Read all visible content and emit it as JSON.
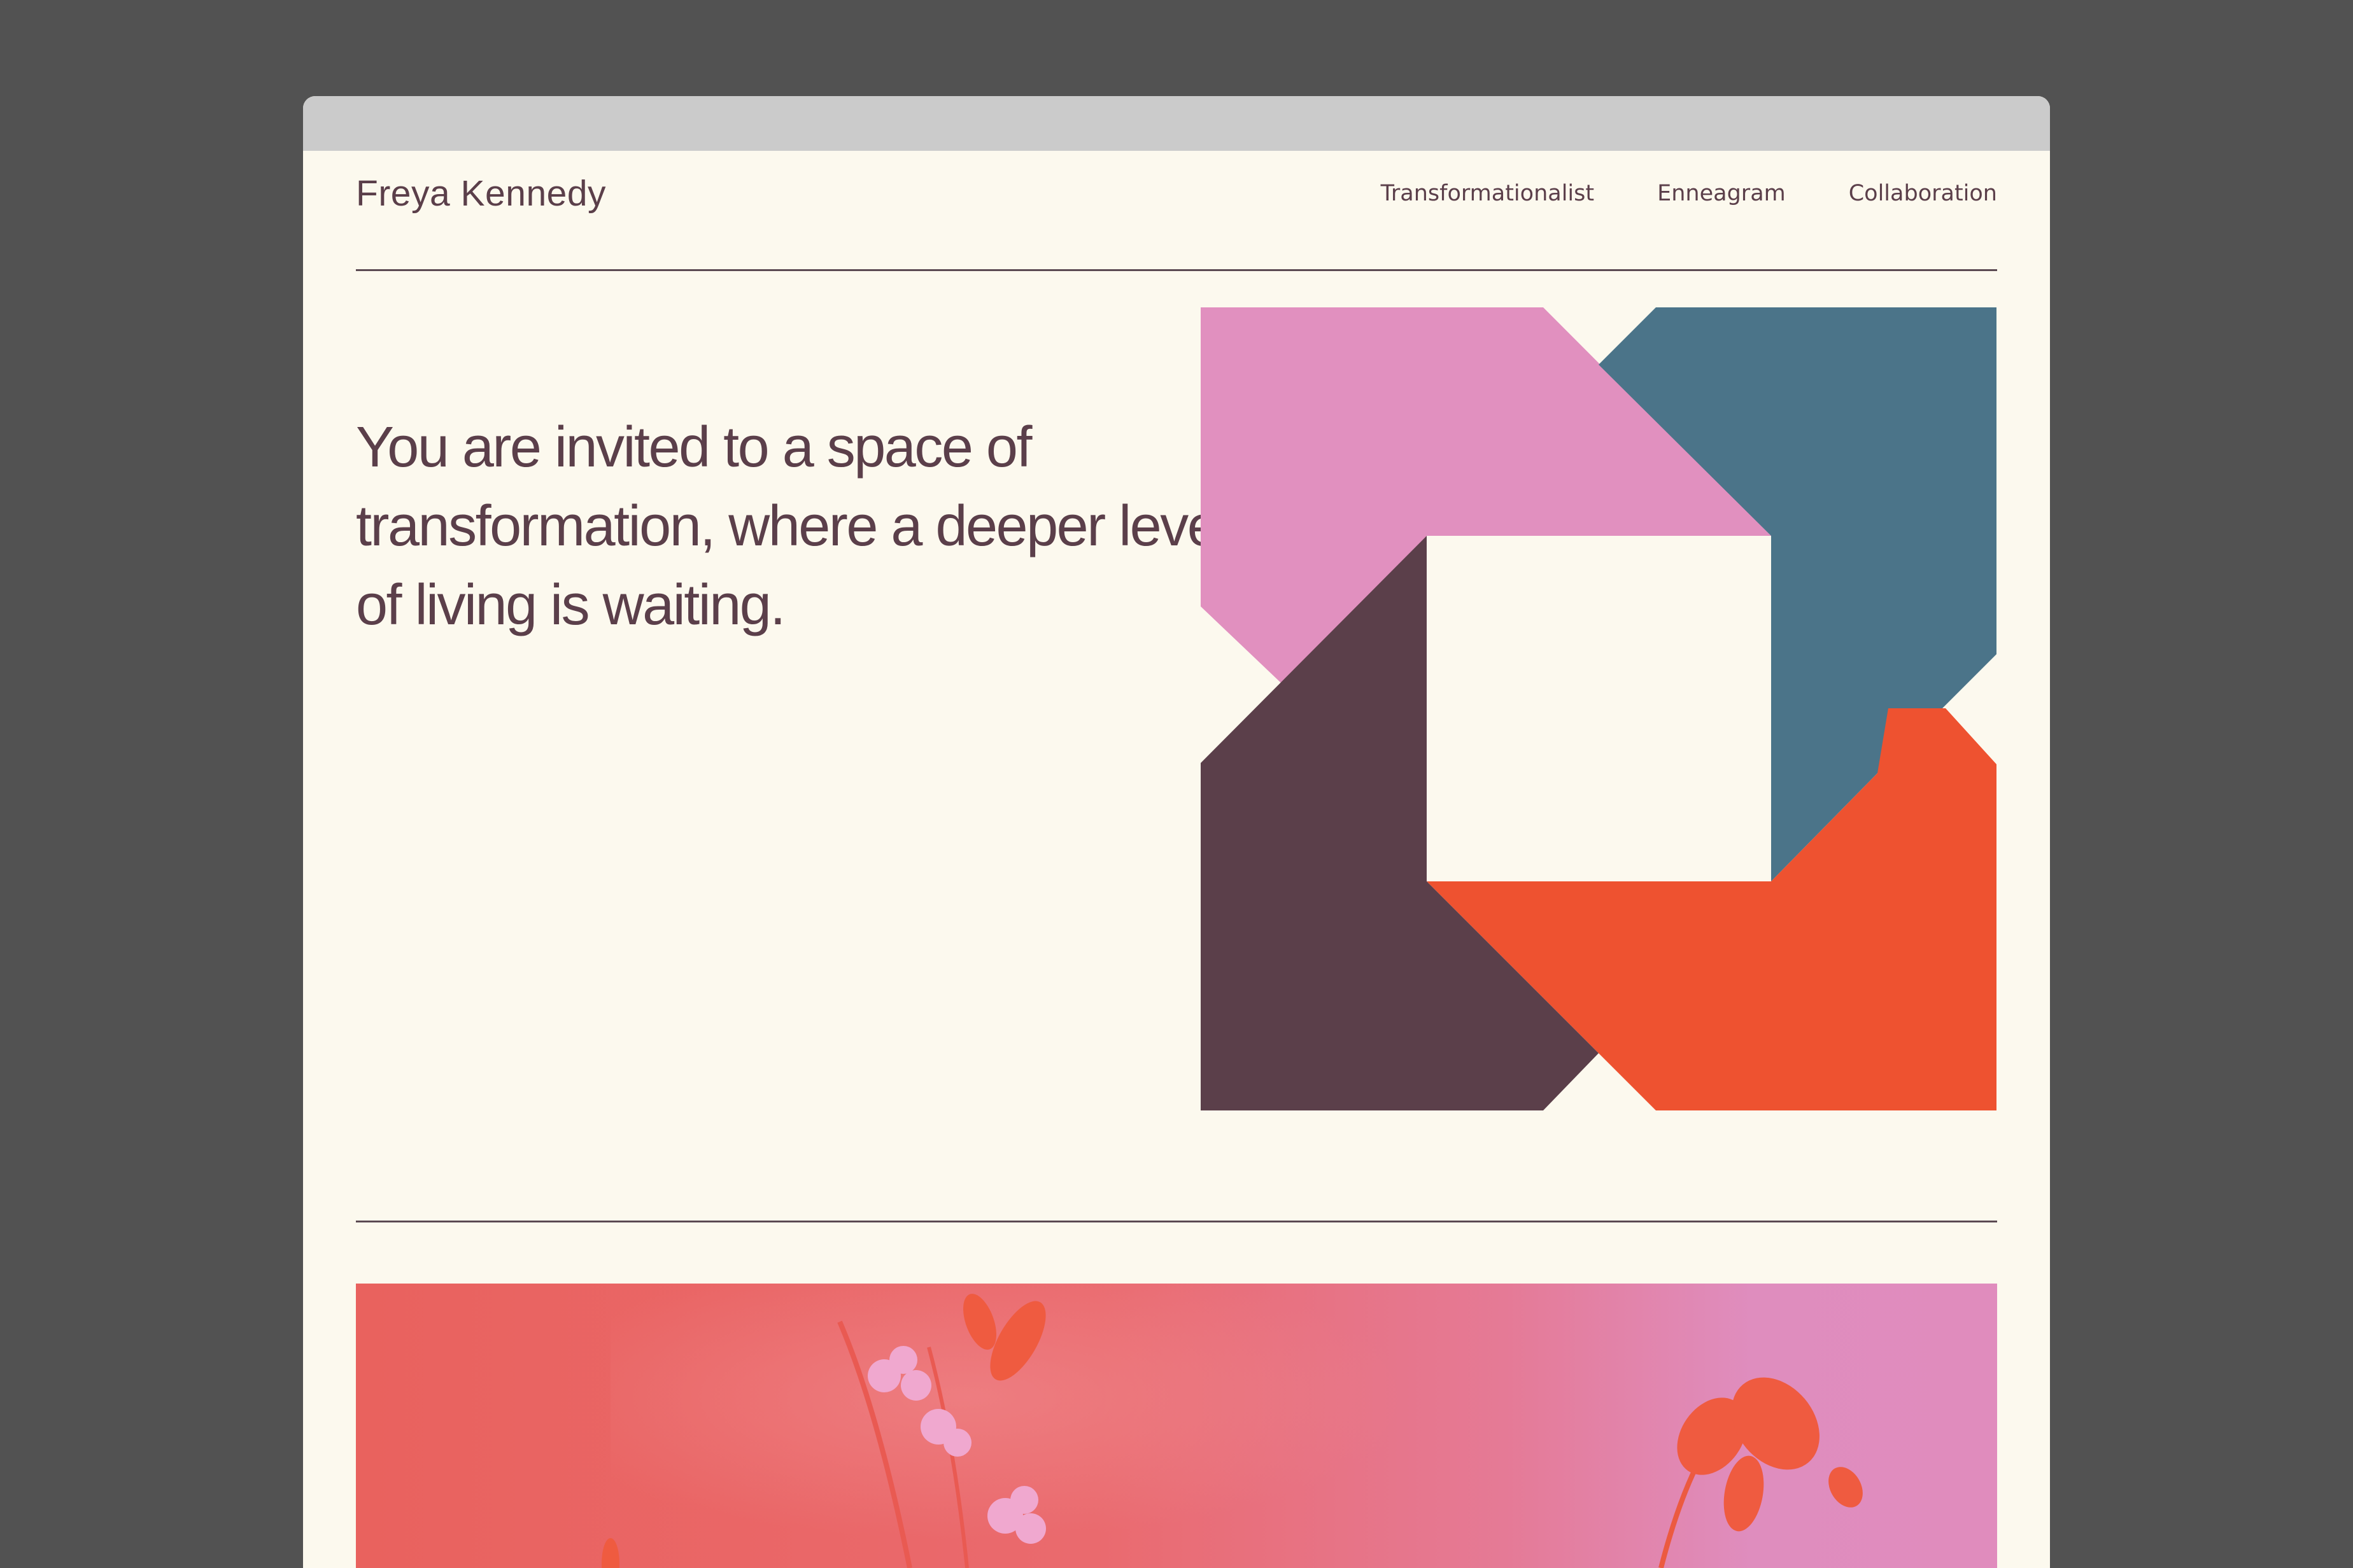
{
  "site": {
    "logo_text": "Freya Kennedy"
  },
  "nav": {
    "items": [
      {
        "label": "Transformationalist"
      },
      {
        "label": "Enneagram"
      },
      {
        "label": "Collaboration"
      }
    ]
  },
  "hero": {
    "headline": "You are invited to a space of transformation, where a deeper level of living is waiting."
  },
  "colors": {
    "background": "#fcf9ee",
    "text": "#5b3f4a",
    "pink": "#e190bf",
    "blue": "#4b7489",
    "plum": "#5b3f4a",
    "orange": "#ee5230"
  }
}
